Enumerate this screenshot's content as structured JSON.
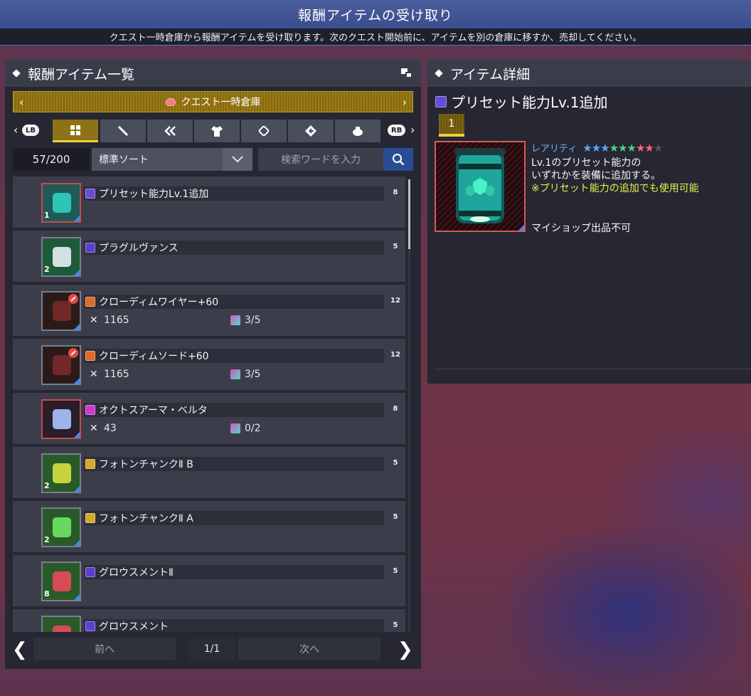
{
  "header": {
    "title": "報酬アイテムの受け取り",
    "subtitle": "クエスト一時倉庫から報酬アイテムを受け取ります。次のクエスト開始前に、アイテムを別の倉庫に移すか、売却してください。"
  },
  "left_panel": {
    "title": "報酬アイテム一覧",
    "storage_name": "クエスト一時倉庫",
    "tabs": [
      "all",
      "sword-icon",
      "rod-icon",
      "shirt-icon",
      "tag-icon",
      "arrow-icon",
      "pot-icon"
    ],
    "lb_label": "LB",
    "rb_label": "RB",
    "count": "57/200",
    "sort": "標準ソート",
    "search_placeholder": "検索ワードを入力",
    "items": [
      {
        "name": "プリセット能力Lv.1追加",
        "qty": "1",
        "level": "8",
        "type_color": "#6a4bd8",
        "stat1": "",
        "stat2": ""
      },
      {
        "name": "プラグルヴァンス",
        "qty": "2",
        "level": "5",
        "type_color": "#5c3fd0",
        "stat1": "",
        "stat2": ""
      },
      {
        "name": "クローディムワイヤー+60",
        "qty": "",
        "level": "12",
        "type_color": "#e06a28",
        "stat1": "1165",
        "stat2": "3/5"
      },
      {
        "name": "クローディムソード+60",
        "qty": "",
        "level": "12",
        "type_color": "#e06a28",
        "stat1": "1165",
        "stat2": "3/5"
      },
      {
        "name": "オクトスアーマ・ベルタ",
        "qty": "",
        "level": "8",
        "type_color": "#c93ad0",
        "stat1": "43",
        "stat2": "0/2"
      },
      {
        "name": "フォトンチャンクⅡ B",
        "qty": "2",
        "level": "5",
        "type_color": "#d6a82a",
        "stat1": "",
        "stat2": ""
      },
      {
        "name": "フォトンチャンクⅡ A",
        "qty": "2",
        "level": "5",
        "type_color": "#d6a82a",
        "stat1": "",
        "stat2": ""
      },
      {
        "name": "グロウスメントⅡ",
        "qty": "8",
        "level": "5",
        "type_color": "#5c3fd0",
        "stat1": "",
        "stat2": ""
      },
      {
        "name": "グロウスメント",
        "qty": "",
        "level": "5",
        "type_color": "#5c3fd0",
        "stat1": "",
        "stat2": ""
      }
    ],
    "pager": {
      "prev": "前へ",
      "page": "1/1",
      "next": "次へ"
    }
  },
  "right_panel": {
    "title": "アイテム詳細",
    "item_name": "プリセット能力Lv.1追加",
    "qty": "1",
    "rarity_label": "レアリティ",
    "rarity_stars": 8,
    "rarity_max": 9,
    "desc_line1": "Lv.1のプリセット能力の",
    "desc_line2": "いずれかを装備に追加する。",
    "desc_highlight": "※プリセット能力の追加でも使用可能",
    "shop_note": "マイショップ出品不可"
  }
}
